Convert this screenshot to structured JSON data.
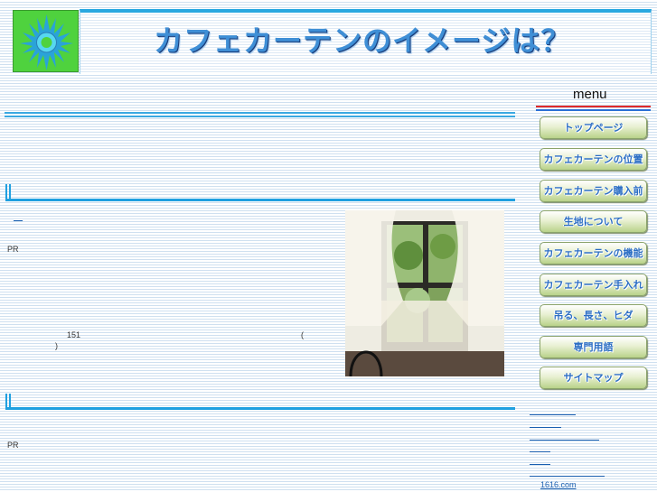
{
  "header": {
    "title": "カフェカーテンのイメージは？"
  },
  "menu": {
    "heading": "menu",
    "items": [
      {
        "label": "トップページ"
      },
      {
        "label": "カフェカーテンの位置"
      },
      {
        "label": "カフェカーテン購入前"
      },
      {
        "label": "生地について"
      },
      {
        "label": "カフェカーテンの機能"
      },
      {
        "label": "カフェカーテン手入れ"
      },
      {
        "label": "吊る、長さ、ヒダ"
      },
      {
        "label": "専門用語"
      },
      {
        "label": "サイトマップ"
      }
    ]
  },
  "content": {
    "pr_1": "PR",
    "num": "151",
    "paren_open": "(",
    "paren_close": ")",
    "pr_2": "PR"
  },
  "footer": {
    "site_name": "1616.com"
  }
}
